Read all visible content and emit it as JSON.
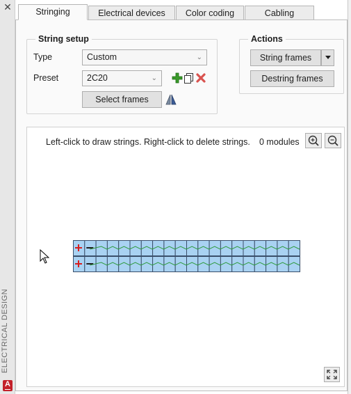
{
  "window": {
    "side_label": "ELECTRICAL DESIGN",
    "close_icon": "close-icon",
    "app_badge_letter": "A"
  },
  "tabs": [
    {
      "label": "Stringing",
      "active": true
    },
    {
      "label": "Electrical devices",
      "active": false
    },
    {
      "label": "Color coding",
      "active": false
    },
    {
      "label": "Cabling",
      "active": false
    }
  ],
  "string_setup": {
    "title": "String setup",
    "type_label": "Type",
    "type_value": "Custom",
    "preset_label": "Preset",
    "preset_value": "2C20",
    "select_frames_label": "Select frames",
    "icons": [
      "add-preset-icon",
      "copy-preset-icon",
      "delete-preset-icon",
      "mirror-icon"
    ]
  },
  "actions": {
    "title": "Actions",
    "string_frames_label": "String frames",
    "destring_frames_label": "Destring frames"
  },
  "canvas": {
    "hint": "Left-click to draw strings. Right-click to delete strings.",
    "modules_count": "0 modules",
    "zoom_in_icon": "zoom-in-icon",
    "zoom_out_icon": "zoom-out-icon",
    "fullscreen_icon": "fullscreen-icon",
    "rows": 2,
    "modules_per_row": 20
  },
  "colors": {
    "module_fill": "#a9d2f2",
    "module_border": "#3a4f6a",
    "string_wire": "#2e9a3e",
    "positive_terminal": "#d81e1e",
    "negative_terminal": "#1e1e1e",
    "delete_red": "#d9534f",
    "add_green": "#3a9a2a"
  }
}
